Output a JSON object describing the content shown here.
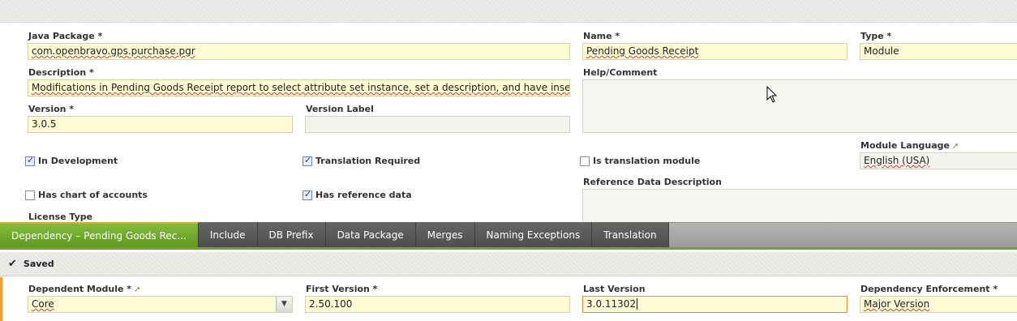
{
  "form": {
    "java_package": {
      "label": "Java Package *",
      "value": "com.openbravo.gps.purchase.pgr"
    },
    "name": {
      "label": "Name *",
      "value": "Pending Goods Receipt"
    },
    "type": {
      "label": "Type *",
      "value": "Module"
    },
    "description": {
      "label": "Description *",
      "value": "Modifications in Pending Goods Receipt report to select attribute set instance, set a description, and have inserted a defaul"
    },
    "help_comment": {
      "label": "Help/Comment",
      "value": ""
    },
    "version": {
      "label": "Version *",
      "value": "3.0.5"
    },
    "version_label": {
      "label": "Version Label",
      "value": ""
    },
    "in_development": {
      "label": "In Development",
      "checked": true
    },
    "translation_required": {
      "label": "Translation Required",
      "checked": true
    },
    "is_translation_module": {
      "label": "Is translation module",
      "checked": false
    },
    "module_language": {
      "label": "Module Language",
      "value": "English (USA)"
    },
    "has_chart_of_accounts": {
      "label": "Has chart of accounts",
      "checked": false
    },
    "has_reference_data": {
      "label": "Has reference data",
      "checked": true
    },
    "reference_data_description": {
      "label": "Reference Data Description",
      "value": ""
    },
    "license_type": {
      "label": "License Type"
    }
  },
  "tabs": [
    {
      "label": "Dependency – Pending Goods Rec...",
      "active": true
    },
    {
      "label": "Include",
      "active": false
    },
    {
      "label": "DB Prefix",
      "active": false
    },
    {
      "label": "Data Package",
      "active": false
    },
    {
      "label": "Merges",
      "active": false
    },
    {
      "label": "Naming Exceptions",
      "active": false
    },
    {
      "label": "Translation",
      "active": false
    }
  ],
  "status": {
    "icon": "checkmark-icon",
    "text": "Saved"
  },
  "dependency": {
    "dependent_module": {
      "label": "Dependent Module *",
      "value": "Core"
    },
    "first_version": {
      "label": "First Version *",
      "value": "2.50.100"
    },
    "last_version": {
      "label": "Last Version",
      "value": "3.0.11302"
    },
    "dependency_enforcement": {
      "label": "Dependency Enforcement *",
      "value": "Major Version"
    }
  },
  "colors": {
    "accent_green": "#6fa524",
    "field_yellow": "#fdfbd3",
    "focus_orange": "#e08a3c"
  }
}
